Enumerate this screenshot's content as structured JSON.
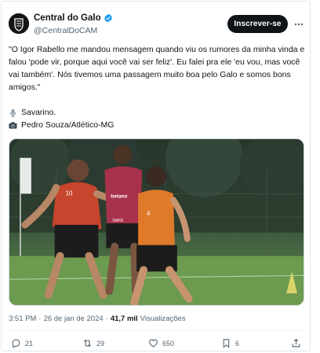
{
  "author": {
    "display_name": "Central do Galo",
    "handle": "@CentralDoCAM",
    "verified": true
  },
  "follow_button": {
    "label": "Inscrever-se"
  },
  "tweet": {
    "text": "\"O Igor Rabello me mandou mensagem quando viu os rumores da minha vinda e falou 'pode vir, porque aqui você vai ser feliz'. Eu falei pra ele 'eu vou, mas você vai também'. Nós tivemos uma passagem muito boa pelo Galo e somos bons amigos.\"",
    "line1": {
      "icon": "microphone-icon",
      "text": "Savarino."
    },
    "line2": {
      "icon": "camera-icon",
      "text": "Pedro Souza/Atlético-MG"
    }
  },
  "media": {
    "type": "photo",
    "player_numbers": [
      "10",
      "4"
    ],
    "shirt_texts": [
      "SAFE",
      "betano"
    ]
  },
  "meta": {
    "time": "3:51 PM",
    "separator": "·",
    "date": "26 de jan de 2024",
    "views_count": "41,7 mil",
    "views_label": "Visualizações"
  },
  "actions": {
    "replies": "21",
    "retweets": "29",
    "likes": "650",
    "bookmarks": "6"
  },
  "colors": {
    "follow_bg": "#0f1419",
    "verified": "#1d9bf0",
    "secondary_text": "#536471"
  }
}
